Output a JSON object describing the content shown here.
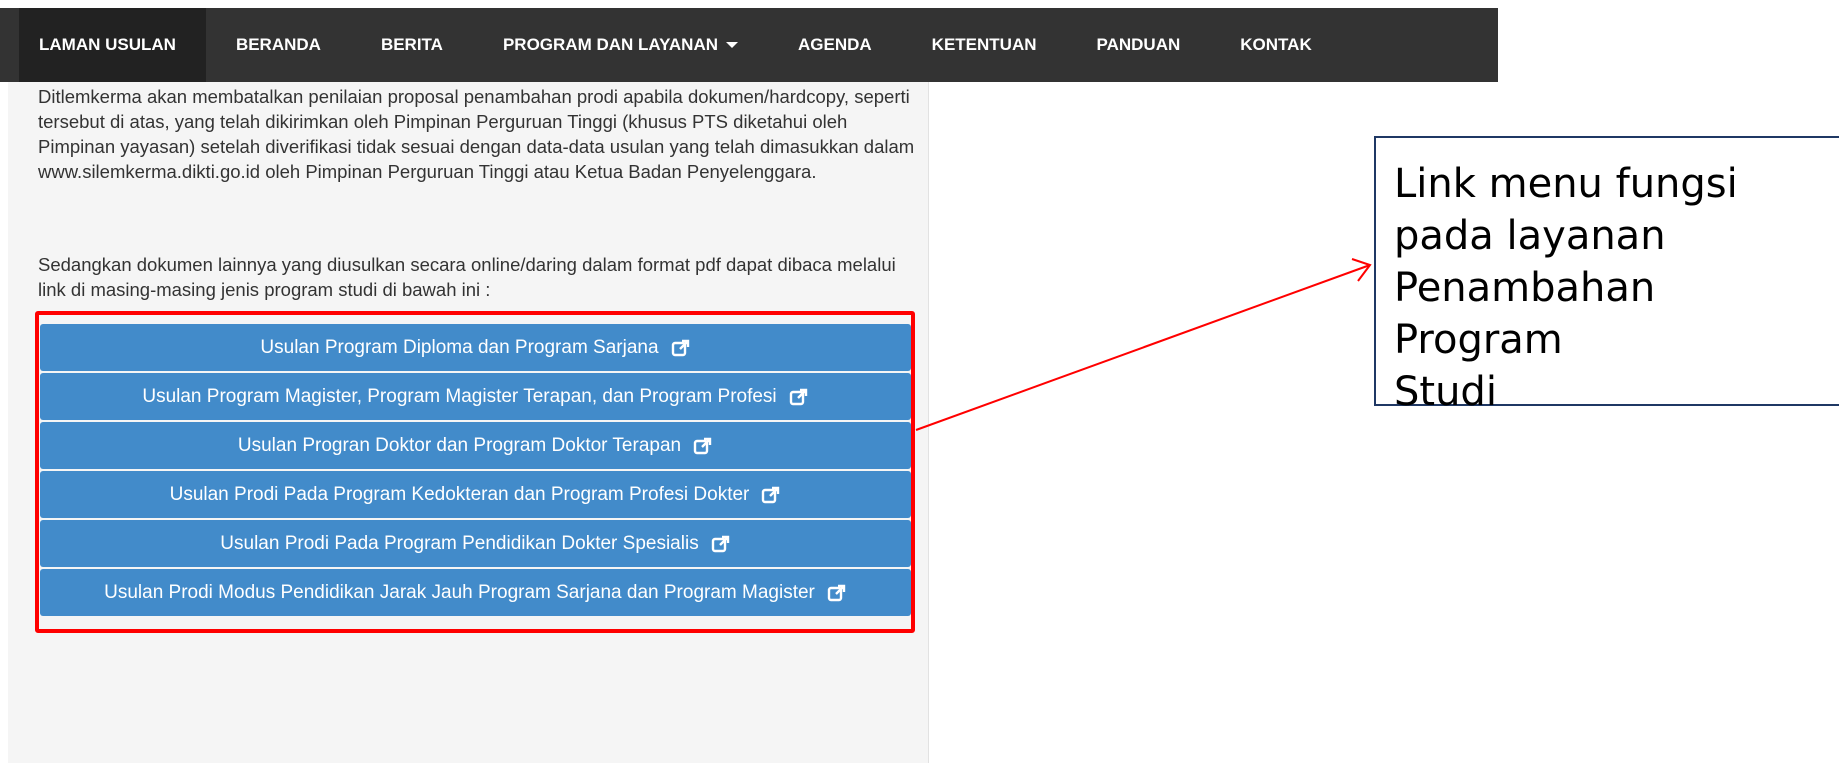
{
  "nav": {
    "items": [
      {
        "label": "LAMAN USULAN",
        "active": true
      },
      {
        "label": "BERANDA"
      },
      {
        "label": "BERITA"
      },
      {
        "label": "PROGRAM DAN LAYANAN",
        "dropdown": true
      },
      {
        "label": "AGENDA"
      },
      {
        "label": "KETENTUAN"
      },
      {
        "label": "PANDUAN"
      },
      {
        "label": "KONTAK"
      }
    ]
  },
  "content": {
    "paragraph1": "Ditlemkerma akan membatalkan penilaian proposal penambahan prodi apabila dokumen/hardcopy, seperti tersebut di atas, yang telah dikirimkan oleh Pimpinan Perguruan Tinggi (khusus PTS diketahui oleh Pimpinan yayasan) setelah diverifikasi tidak sesuai dengan data-data usulan yang telah dimasukkan dalam www.silemkerma.dikti.go.id oleh Pimpinan Perguruan Tinggi atau Ketua Badan Penyelenggara.",
    "paragraph2": "Sedangkan dokumen lainnya yang diusulkan secara online/daring dalam format pdf dapat dibaca melalui link di masing-masing jenis program studi di bawah ini :",
    "links": [
      {
        "label": "Usulan Program Diploma dan Program Sarjana",
        "icon": "external-link-icon"
      },
      {
        "label": "Usulan Program Magister, Program Magister Terapan, dan Program Profesi",
        "icon": "external-link-icon"
      },
      {
        "label": "Usulan Progran Doktor dan Program Doktor Terapan",
        "icon": "external-link-icon"
      },
      {
        "label": "Usulan Prodi Pada Program Kedokteran dan Program Profesi Dokter",
        "icon": "external-link-icon"
      },
      {
        "label": "Usulan Prodi Pada Program Pendidikan Dokter Spesialis",
        "icon": "external-link-icon"
      },
      {
        "label": "Usulan Prodi Modus Pendidikan Jarak Jauh Program Sarjana dan Program Magister",
        "icon": "external-link-icon"
      }
    ]
  },
  "annotation": {
    "callout_lines": [
      "Link menu fungsi",
      "pada layanan",
      "Penambahan Program",
      "Studi"
    ],
    "highlight_color": "#ff0000",
    "border_color": "#1f3864"
  },
  "colors": {
    "navbar_bg": "#333333",
    "navbar_active_bg": "#222222",
    "button_bg": "#428bca",
    "panel_bg": "#f5f5f5"
  }
}
